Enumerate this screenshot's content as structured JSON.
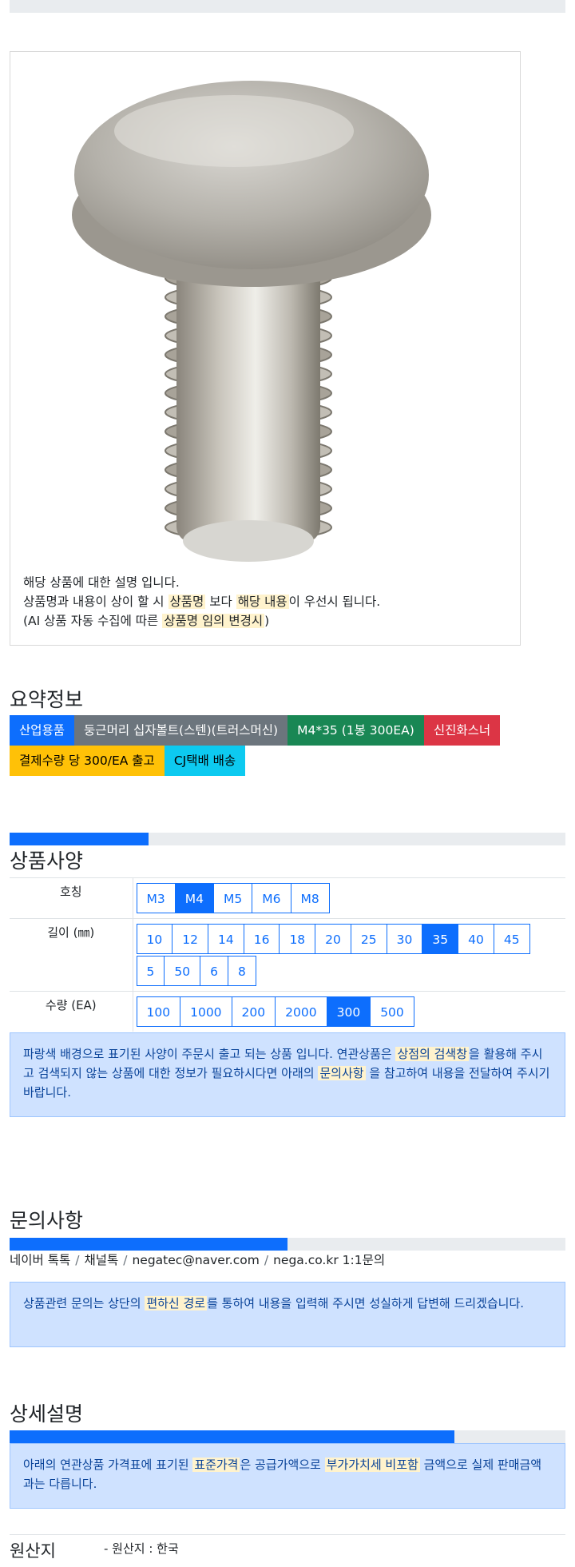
{
  "product_desc": {
    "line1": "해당 상품에 대한 설명 입니다.",
    "line2_a": "상품명과 내용이 상이 할 시 ",
    "line2_hl1": "상품명",
    "line2_b": " 보다 ",
    "line2_hl2": "해당 내용",
    "line2_c": "이 우선시 됩니다.",
    "line3_a": "(AI 상품 자동 수집에 따른 ",
    "line3_hl": "상품명 임의 변경시",
    "line3_b": ")"
  },
  "summary": {
    "title": "요약정보",
    "badges_row1": [
      {
        "label": "산업용품",
        "color": "#0d6efd"
      },
      {
        "label": "둥근머리 십자볼트(스텐)(트러스머신)",
        "color": "#6c757d"
      },
      {
        "label": "M4*35 (1봉 300EA)",
        "color": "#198754"
      },
      {
        "label": "신진화스너",
        "color": "#dc3545"
      }
    ],
    "badges_row2": [
      {
        "label": "결제수량 당 300/EA 출고",
        "color": "#ffc107",
        "text_color": "#000000"
      },
      {
        "label": "CJ택배 배송",
        "color": "#0dcaf0",
        "text_color": "#000000"
      }
    ]
  },
  "spec": {
    "title": "상품사양",
    "progress": 0.25,
    "rows": [
      {
        "label": "호칭",
        "options": [
          [
            "M3",
            "M4",
            "M5",
            "M6",
            "M8"
          ]
        ],
        "selected": "M4"
      },
      {
        "label": "길이 (㎜)",
        "options": [
          [
            "10",
            "12",
            "14",
            "16",
            "18",
            "20",
            "25",
            "30",
            "35",
            "40",
            "45"
          ],
          [
            "5",
            "50",
            "6",
            "8"
          ]
        ],
        "selected": "35"
      },
      {
        "label": "수량 (EA)",
        "options": [
          [
            "100",
            "1000",
            "200",
            "2000",
            "300",
            "500"
          ]
        ],
        "selected": "300"
      }
    ],
    "notice_a": "파랑색 배경으로 표기된 사양이 주문시 출고 되는 상품 입니다. 연관상품은 ",
    "notice_hl1": "상점의 검색창",
    "notice_b": "을 활용해 주시고 검색되지 않는 상품에 대한 정보가 필요하시다면 아래의 ",
    "notice_hl2": "문의사항",
    "notice_c": " 을 참고하여 내용을 전달하여 주시기 바랍니다."
  },
  "inquiry": {
    "title": "문의사항",
    "progress": 0.5,
    "links": [
      "네이버 톡톡",
      "채널톡",
      "negatec@naver.com",
      "nega.co.kr 1:1문의"
    ],
    "separator": "/",
    "notice_a": "상품관련 문의는 상단의 ",
    "notice_hl": "편하신 경로",
    "notice_b": "를 통하여 내용을 입력해 주시면 성실하게 답변해 드리겠습니다."
  },
  "detail": {
    "title": "상세설명",
    "progress": 0.8,
    "notice_a": "아래의 연관상품 가격표에 표기된 ",
    "notice_hl1": "표준가격",
    "notice_b": "은 공급가액으로 ",
    "notice_hl2": "부가가치세 비포함",
    "notice_c": " 금액으로 실제 판매금액과는 다릅니다."
  },
  "origin": {
    "label": "원산지",
    "value": "- 원산지 : 한국"
  }
}
